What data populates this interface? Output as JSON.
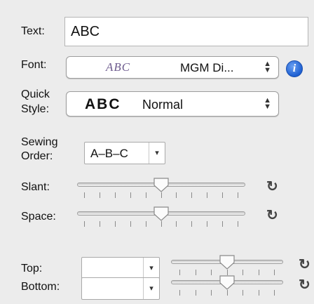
{
  "labels": {
    "text": "Text:",
    "font": "Font:",
    "quick_style_1": "Quick",
    "quick_style_2": "Style:",
    "sewing_order_1": "Sewing",
    "sewing_order_2": "Order:",
    "slant": "Slant:",
    "space": "Space:",
    "top": "Top:",
    "bottom": "Bottom:"
  },
  "text_field": {
    "value": "ABC"
  },
  "font_popup": {
    "preview": "ABC",
    "value": "MGM Di...",
    "stepper": "⇕"
  },
  "quick_style_popup": {
    "preview": "ABC",
    "value": "Normal"
  },
  "sewing_order": {
    "value": "A–B–C",
    "arrow": "▾"
  },
  "top_combo": {
    "value": "",
    "arrow": "▾"
  },
  "bottom_combo": {
    "value": "",
    "arrow": "▾"
  },
  "sliders": {
    "slant": {
      "value": 0.5,
      "tick_count": 11
    },
    "space": {
      "value": 0.5,
      "tick_count": 11
    },
    "top": {
      "value": 0.5,
      "tick_count": 7
    },
    "bottom": {
      "value": 0.5,
      "tick_count": 7
    }
  },
  "icons": {
    "info": "i",
    "reset": "↻"
  }
}
